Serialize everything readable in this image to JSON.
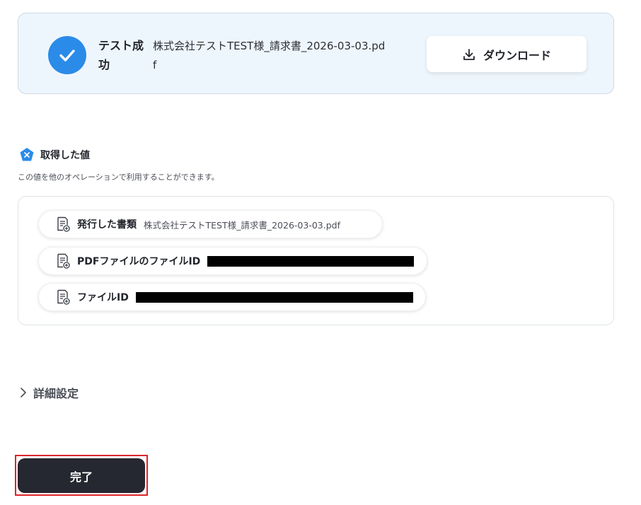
{
  "result": {
    "status_label": "テスト成功",
    "file_name": "株式会社テストTEST様_請求書_2026-03-03.pdf",
    "download_label": "ダウンロード"
  },
  "acquired": {
    "title": "取得した値",
    "description": "この値を他のオペレーションで利用することができます。",
    "items": [
      {
        "label": "発行した書類",
        "value": "株式会社テストTEST様_請求書_2026-03-03.pdf"
      },
      {
        "label": "PDFファイルのファイルID",
        "value": ""
      },
      {
        "label": "ファイルID",
        "value": ""
      }
    ]
  },
  "details": {
    "label": "詳細設定"
  },
  "footer": {
    "complete_label": "完了"
  },
  "colors": {
    "accent": "#2b8be8",
    "primary_button": "#252830",
    "highlight": "#d9252a",
    "panel_bg": "#eef6fd"
  }
}
